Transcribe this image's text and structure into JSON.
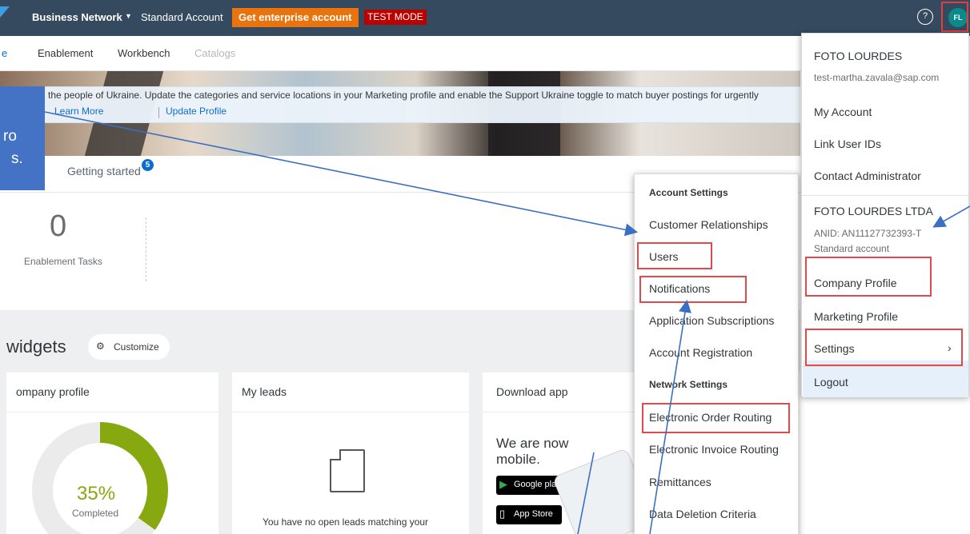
{
  "topbar": {
    "brand": "Business Network",
    "account_type": "Standard Account",
    "enterprise_button": "Get enterprise account",
    "test_mode": "TEST MODE",
    "help_glyph": "?",
    "avatar_initials": "FL"
  },
  "nav": {
    "items": [
      "e",
      "Enablement",
      "Workbench",
      "Catalogs"
    ]
  },
  "banner": {
    "text": "the people of Ukraine. Update the categories and service locations in your Marketing profile and enable the Support Ukraine toggle to match buyer postings for urgently",
    "learn_more": "Learn More",
    "update_profile": "Update Profile"
  },
  "callout": {
    "line1": "ro",
    "line2": "s."
  },
  "getting_started": {
    "label": "Getting started",
    "badge": "5"
  },
  "enablement": {
    "count": "0",
    "label": "Enablement Tasks"
  },
  "widgets": {
    "title": "widgets",
    "customize_icon": "⚙",
    "customize": "Customize",
    "cards": [
      {
        "title": "ompany profile",
        "percent": "35%",
        "percent_value": 35,
        "status": "Completed"
      },
      {
        "title": "My leads",
        "message": "You have no open leads matching your"
      },
      {
        "title": "Download app",
        "line1": "We are now",
        "line2": "mobile.",
        "google_play": "Google play",
        "app_store": "App Store"
      }
    ]
  },
  "settings_menu": {
    "account_header": "Account Settings",
    "account_items": [
      "Customer Relationships",
      "Users",
      "Notifications",
      "Application Subscriptions",
      "Account Registration"
    ],
    "network_header": "Network Settings",
    "network_items": [
      "Electronic Order Routing",
      "Electronic Invoice Routing",
      "Remittances",
      "Data Deletion Criteria"
    ]
  },
  "user_menu": {
    "name": "FOTO LOURDES",
    "email": "test-martha.zavala@sap.com",
    "items": [
      "My Account",
      "Link User IDs",
      "Contact Administrator"
    ],
    "company": "FOTO LOURDES LTDA",
    "anid": "ANID: AN11127732393-T",
    "account_level": "Standard account",
    "company_items": [
      "Company Profile",
      "Marketing Profile"
    ],
    "settings": "Settings",
    "settings_chevron": "›",
    "logout": "Logout"
  },
  "colors": {
    "topbar": "#354a5f",
    "enterprise": "#e9730c",
    "test_mode": "#bb0000",
    "avatar": "#0a8a8a",
    "donut": "#88a80f",
    "callout": "#4472c4",
    "highlight": "#e04a4a",
    "arrow": "#3a6fc4"
  }
}
